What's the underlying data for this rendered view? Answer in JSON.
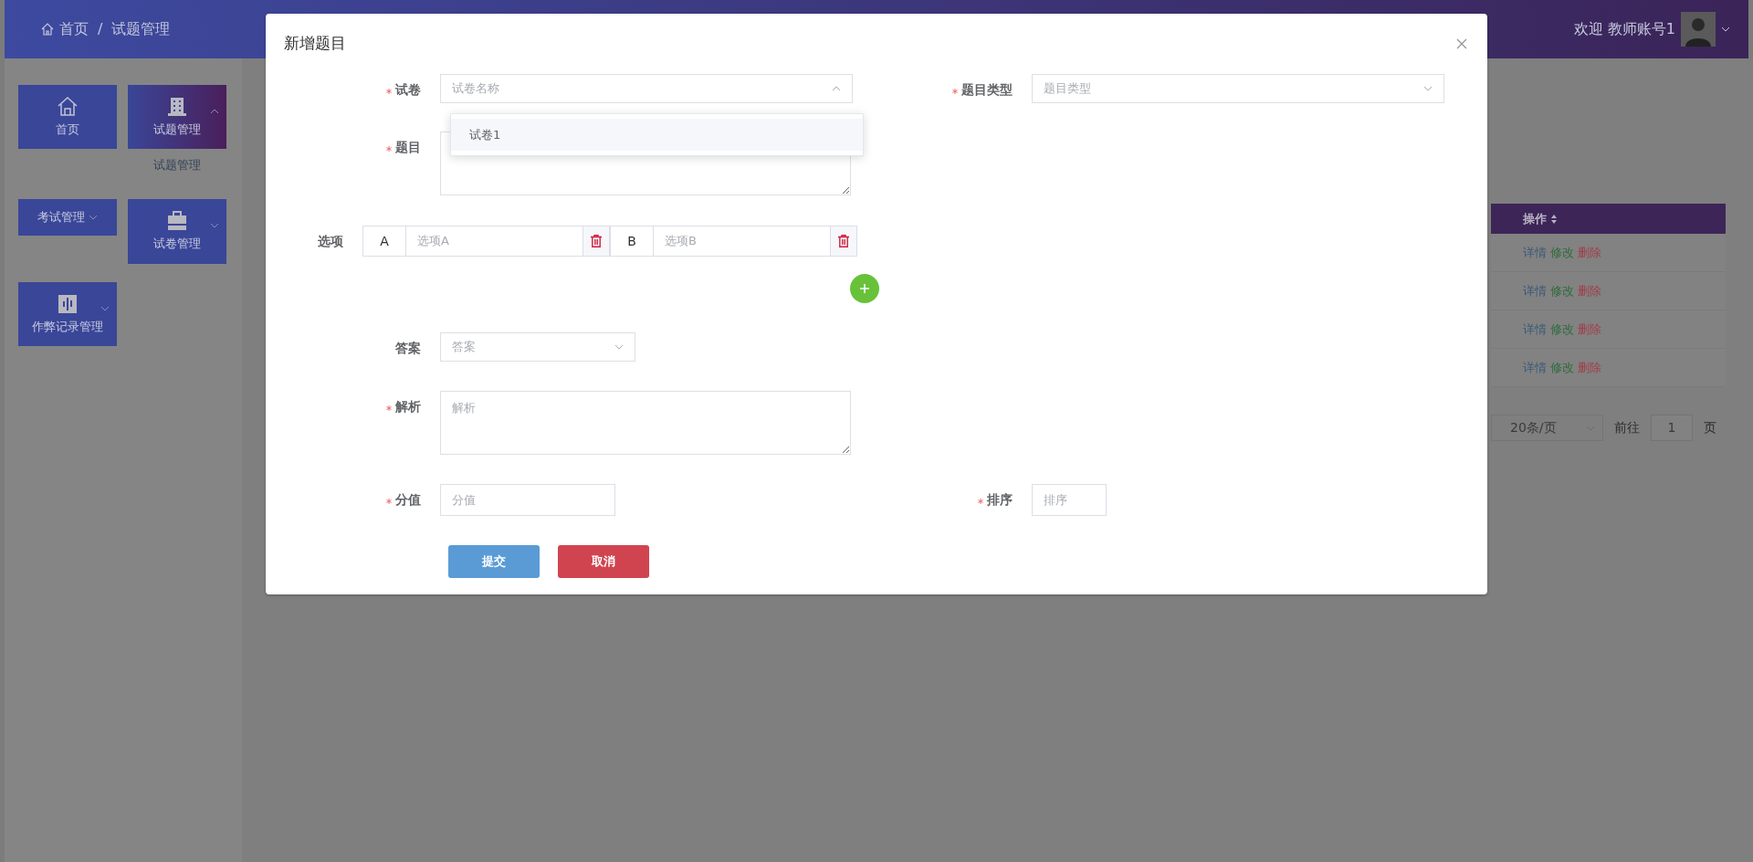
{
  "header": {
    "breadcrumb": [
      {
        "label": "首页"
      },
      {
        "label": "试题管理"
      }
    ],
    "separator": "/",
    "welcome": "欢迎 教师账号1"
  },
  "sidebar": {
    "items": [
      {
        "label": "首页",
        "active": false
      },
      {
        "label": "试题管理",
        "active": true,
        "expanded": true,
        "children": [
          {
            "label": "试题管理"
          }
        ]
      },
      {
        "label": "考试管理",
        "active": false,
        "expanded": false
      },
      {
        "label": "试卷管理",
        "active": false,
        "expanded": false
      },
      {
        "label": "作弊记录管理",
        "active": false,
        "expanded": false
      }
    ]
  },
  "table": {
    "columns": [
      {
        "label": "操作"
      }
    ],
    "rows": [
      {
        "actions": [
          {
            "label": "详情",
            "kind": "detail"
          },
          {
            "label": "修改",
            "kind": "edit"
          },
          {
            "label": "删除",
            "kind": "delete"
          }
        ]
      },
      {
        "actions": [
          {
            "label": "详情",
            "kind": "detail"
          },
          {
            "label": "修改",
            "kind": "edit"
          },
          {
            "label": "删除",
            "kind": "delete"
          }
        ]
      },
      {
        "actions": [
          {
            "label": "详情",
            "kind": "detail"
          },
          {
            "label": "修改",
            "kind": "edit"
          },
          {
            "label": "删除",
            "kind": "delete"
          }
        ]
      },
      {
        "actions": [
          {
            "label": "详情",
            "kind": "detail"
          },
          {
            "label": "修改",
            "kind": "edit"
          },
          {
            "label": "删除",
            "kind": "delete"
          }
        ]
      }
    ]
  },
  "pagination": {
    "page_size": "20条/页",
    "goto_label": "前往",
    "page": "1",
    "page_suffix": "页"
  },
  "dialog": {
    "title": "新增题目",
    "rows": [
      [
        {
          "kind": "select",
          "label": "试卷",
          "required": true,
          "placeholder": "试卷名称",
          "expanded": true,
          "menu": [
            {
              "label": "试卷1",
              "highlighted": true
            }
          ]
        },
        {
          "kind": "select",
          "label": "题目类型",
          "required": true,
          "placeholder": "题目类型",
          "expanded": false
        }
      ],
      [
        {
          "kind": "textarea",
          "label": "题目",
          "required": true
        }
      ],
      [
        {
          "kind": "options",
          "label": "选项",
          "required": false,
          "options": [
            {
              "letter": "A",
              "placeholder": "选项A"
            },
            {
              "letter": "B",
              "placeholder": "选项B"
            }
          ]
        }
      ],
      [
        {
          "kind": "select",
          "label": "答案",
          "required": false,
          "placeholder": "答案",
          "expanded": false
        }
      ],
      [
        {
          "kind": "textarea",
          "label": "解析",
          "required": true,
          "placeholder": "解析"
        }
      ],
      [
        {
          "kind": "input",
          "label": "分值",
          "required": true,
          "placeholder": "分值"
        },
        {
          "kind": "input",
          "label": "排序",
          "required": true,
          "placeholder": "排序"
        }
      ]
    ],
    "buttons": [
      {
        "label": "提交",
        "kind": "primary"
      },
      {
        "label": "取消",
        "kind": "danger"
      }
    ]
  }
}
